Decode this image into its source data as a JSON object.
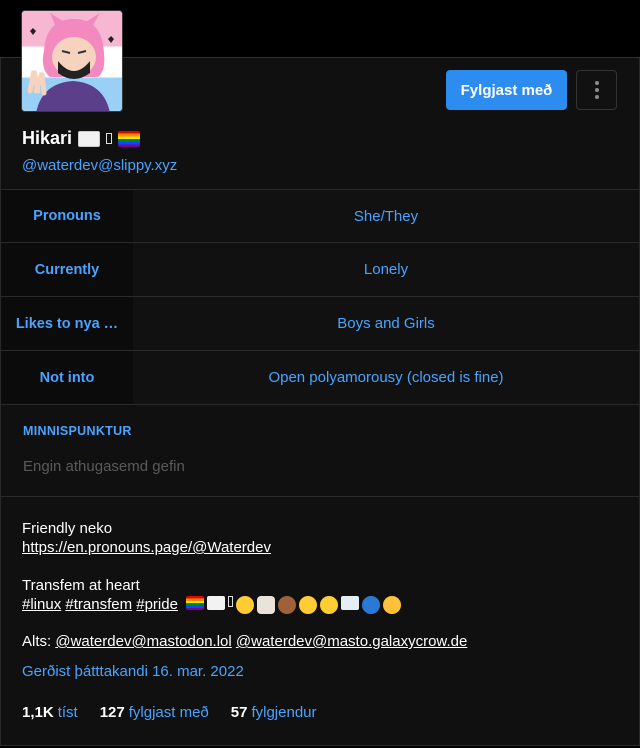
{
  "profile": {
    "display_name": "Hikari",
    "handle": "@waterdev@slippy.xyz",
    "follow_label": "Fylgjast með"
  },
  "fields": [
    {
      "name": "Pronouns",
      "value": "She/They"
    },
    {
      "name": "Currently",
      "value": "Lonely"
    },
    {
      "name": "Likes to nya …",
      "value": "Boys and Girls"
    },
    {
      "name": "Not into",
      "value": "Open polyamorousy (closed is fine)"
    }
  ],
  "note": {
    "label": "MINNISPUNKTUR",
    "placeholder": "Engin athugasemd gefin"
  },
  "bio": {
    "line1": "Friendly neko",
    "link": "https://en.pronouns.page/@Waterdev",
    "line2": "Transfem at heart",
    "tags": [
      "#linux",
      "#transfem",
      "#pride"
    ],
    "alts_prefix": "Alts:",
    "alt1": "@waterdev@mastodon.lol",
    "alt2": "@waterdev@masto.galaxycrow.de"
  },
  "joined": "Gerðist þátttakandi 16. mar. 2022",
  "stats": [
    {
      "num": "1,1K",
      "label": "tíst"
    },
    {
      "num": "127",
      "label": "fylgjast með"
    },
    {
      "num": "57",
      "label": "fylgjendur"
    }
  ],
  "colors": {
    "accent": "#2d8cf0",
    "link": "#4aa3ff",
    "background": "#101010"
  },
  "icons": [
    "more-vertical-icon",
    "white-flag-icon",
    "rainbow-flag-icon"
  ]
}
